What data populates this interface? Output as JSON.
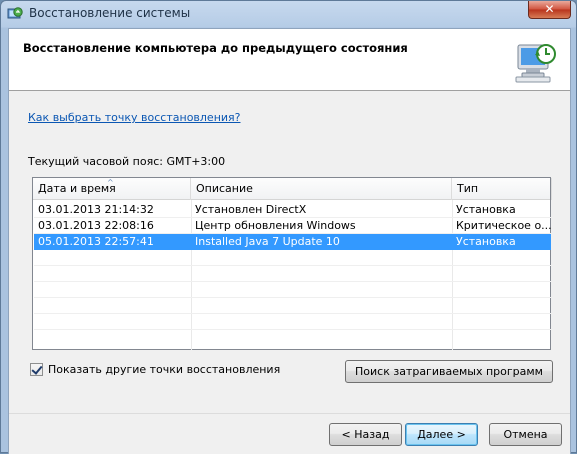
{
  "window": {
    "title": "Восстановление системы",
    "close_label": "✕"
  },
  "header": {
    "title": "Восстановление компьютера до предыдущего состояния"
  },
  "help_link": "Как выбрать точку восстановления?",
  "timezone": "Текущий часовой пояс: GMT+3:00",
  "table": {
    "columns": [
      "Дата и время",
      "Описание",
      "Тип"
    ],
    "sort_indicator": "^",
    "rows": [
      {
        "date": "03.01.2013 21:14:32",
        "description": "Установлен DirectX",
        "type": "Установка",
        "selected": false
      },
      {
        "date": "03.01.2013 22:08:16",
        "description": "Центр обновления Windows",
        "type": "Критическое о...",
        "selected": false
      },
      {
        "date": "05.01.2013 22:57:41",
        "description": "Installed Java 7 Update 10",
        "type": "Установка",
        "selected": true
      }
    ]
  },
  "show_more_checkbox": {
    "label": "Показать другие точки восстановления",
    "checked": true
  },
  "buttons": {
    "scan": "Поиск затрагиваемых программ",
    "back": "< Назад",
    "next": "Далее >",
    "cancel": "Отмена"
  },
  "colors": {
    "selection": "#3399ff",
    "link": "#0b57b3"
  }
}
